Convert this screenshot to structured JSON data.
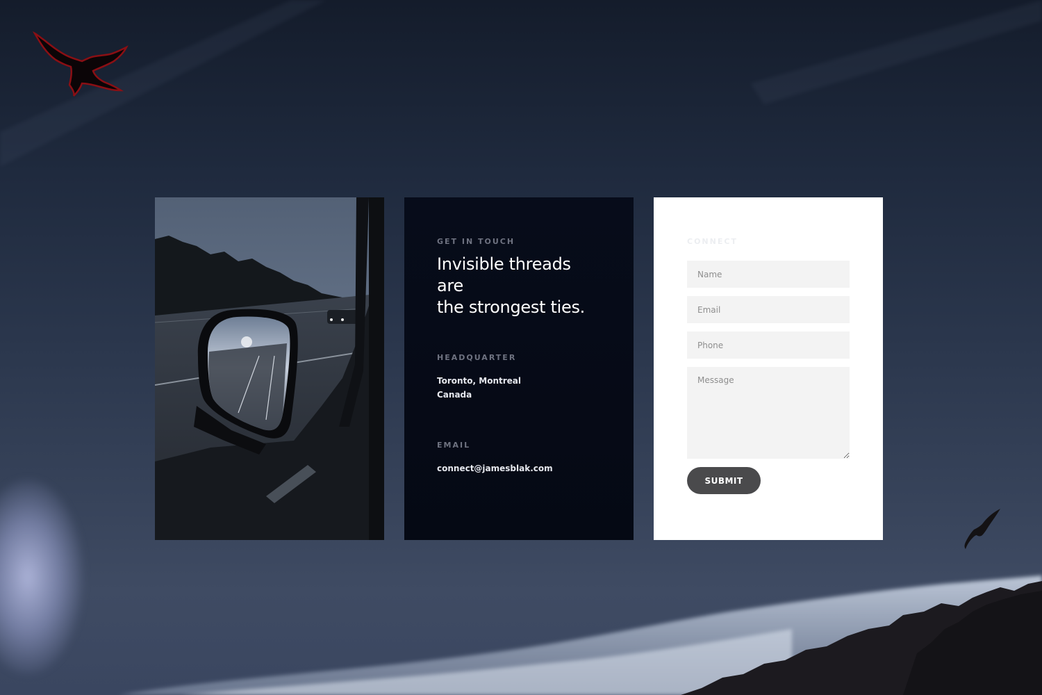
{
  "brand": {
    "logo_icon": "eagle-icon",
    "logo_color": "#8a0f14"
  },
  "info": {
    "eyebrow": "GET IN TOUCH",
    "headline_line1": "Invisible threads are",
    "headline_line2": "the strongest ties.",
    "hq_label": "HEADQUARTER",
    "hq_line1": "Toronto, Montreal",
    "hq_line2": "Canada",
    "email_label": "EMAIL",
    "email_value": "connect@jamesblak.com"
  },
  "form": {
    "eyebrow": "CONNECT",
    "name_placeholder": "Name",
    "email_placeholder": "Email",
    "phone_placeholder": "Phone",
    "message_placeholder": "Message",
    "submit_label": "SUBMIT"
  },
  "colors": {
    "info_panel_bg": "#060b18",
    "submit_bg": "#4a4a4c",
    "field_bg": "#f3f3f3"
  }
}
